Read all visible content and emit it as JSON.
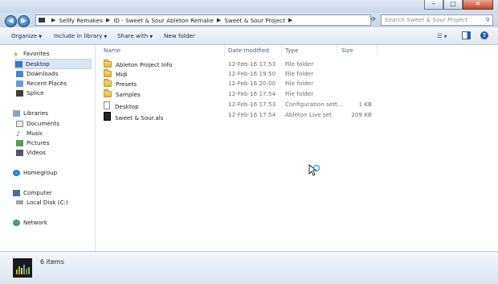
{
  "window": {
    "controls": {
      "minimize": "–",
      "maximize": "□",
      "close": "✕"
    }
  },
  "address": {
    "breadcrumb": [
      "Sellfy Remakes",
      "ID - Sweet & Sour Ableton Remake",
      "Sweet & Sour Project"
    ],
    "search_placeholder": "Search Sweet & Sour Project"
  },
  "toolbar": {
    "organize": "Organize",
    "include_in_library": "Include in library",
    "share_with": "Share with",
    "new_folder": "New folder"
  },
  "sidebar": {
    "favorites": {
      "label": "Favorites",
      "items": [
        "Desktop",
        "Downloads",
        "Recent Places",
        "Splice"
      ]
    },
    "libraries": {
      "label": "Libraries",
      "items": [
        "Documents",
        "Music",
        "Pictures",
        "Videos"
      ]
    },
    "homegroup": "Homegroup",
    "computer": {
      "label": "Computer",
      "items": [
        "Local Disk (C:)"
      ]
    },
    "network": "Network"
  },
  "columns": {
    "name": "Name",
    "date_modified": "Date modified",
    "type": "Type",
    "size": "Size"
  },
  "files": [
    {
      "name": "Ableton Project Info",
      "date": "12-Feb-16 17:53",
      "type": "File folder",
      "size": "",
      "icon": "folder-icon"
    },
    {
      "name": "Midi",
      "date": "12-Feb-16 19:50",
      "type": "File folder",
      "size": "",
      "icon": "folder-icon"
    },
    {
      "name": "Presets",
      "date": "12-Feb-16 20:00",
      "type": "File folder",
      "size": "",
      "icon": "folder-icon"
    },
    {
      "name": "Samples",
      "date": "12-Feb-16 17:54",
      "type": "File folder",
      "size": "",
      "icon": "folder-icon"
    },
    {
      "name": "Desktop",
      "date": "12-Feb-16 17:53",
      "type": "Configuration sett...",
      "size": "1 KB",
      "icon": "config-file-icon"
    },
    {
      "name": "Sweet & Sour.als",
      "date": "12-Feb-16 17:54",
      "type": "Ableton Live set",
      "size": "209 KB",
      "icon": "ableton-file-icon"
    }
  ],
  "status": {
    "item_count": "6 items"
  },
  "colors": {
    "selection": "#dbe7f5",
    "titlebar": "#cbd8e8",
    "link": "#1e2c44"
  }
}
